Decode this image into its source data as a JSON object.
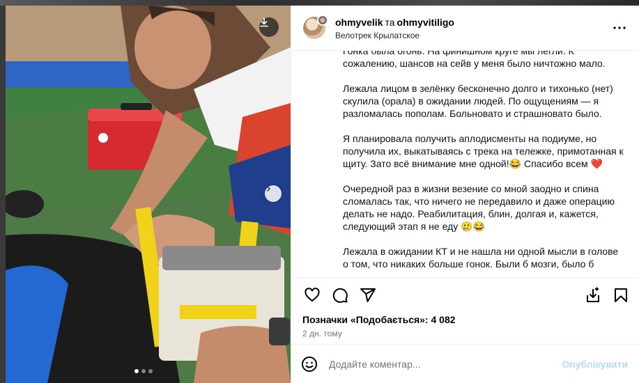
{
  "header": {
    "user1": "ohmyvelik",
    "conjunction": "та",
    "user2": "ohmyvitiligo",
    "location": "Велотрек Крылатское"
  },
  "caption": [
    "Гонка была огонь. На финишном круге мы легли. К сожалению, шансов на сейв у меня было ничтожно мало.",
    "Лежала лицом в зелёнку бесконечно долго и тихонько (нет) скулила (орала) в ожидании людей. По ощущениям — я разломалась пополам. Больновато и страшновато было.",
    "Я планировала получить аплодисменты на подиуме, но получила их, выкатываясь с трека на тележке, примотанная к щиту. Зато всё внимание мне одной!😂 Спасибо всем ❤️",
    "Очередной раз в жизни везение со мной заодно и спина сломалась так, что ничего не передавило и даже операцию делать не надо. Реабилитация, блин, долгая и, кажется, следующий этап я не еду 🥲😂",
    "Лежала в ожидании КТ и не нашла ни одной мысли в голове о том, что никаких больше гонок. Были б мозги, было б"
  ],
  "likes": "Позначки «Подобається»: 4 082",
  "time": "2 дн. тому",
  "comment": {
    "placeholder": "Додайте коментар...",
    "post_label": "Опублікувати"
  },
  "carousel": {
    "slides": 3,
    "active_index": 0
  },
  "icons": [
    "download-icon",
    "chevron-right-icon",
    "more-icon",
    "heart-icon",
    "comment-icon",
    "share-icon",
    "save-to-collection-icon",
    "bookmark-icon",
    "emoji-icon"
  ],
  "colors": {
    "post_button": "#b3dbff",
    "secondary_text": "#737373",
    "divider": "#efefef"
  }
}
